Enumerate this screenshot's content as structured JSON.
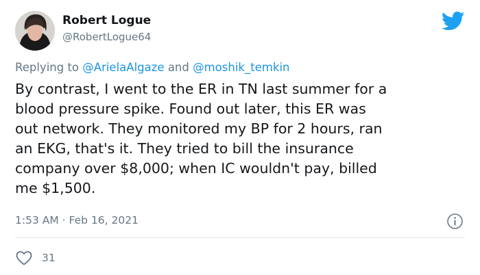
{
  "author": {
    "name": "Robert Logue",
    "handle": "@RobertLogue64"
  },
  "reply": {
    "prefix": "Replying to",
    "user1": "@ArielaAlgaze",
    "connector": "and",
    "user2": "@moshik_temkin"
  },
  "tweet": {
    "lines": [
      "By contrast, I went to the ER in TN last summer for a",
      "blood pressure spike.  Found out later, this ER was",
      "out network. They monitored my BP for 2 hours, ran",
      "an EKG, that's it. They tried to bill the insurance",
      "company over $8,000; when IC wouldn't pay, billed",
      "me $1,500."
    ],
    "time": "1:53 AM",
    "separator": "·",
    "date": "Feb 16, 2021"
  },
  "stats": {
    "likes": "31"
  },
  "icons": {
    "brand": "twitter-bird-icon",
    "info": "info-icon",
    "like": "heart-icon"
  },
  "colors": {
    "twitter_blue": "#1da1f2",
    "link": "#1b95e0",
    "secondary_text": "#657786",
    "primary_text": "#14171a"
  }
}
